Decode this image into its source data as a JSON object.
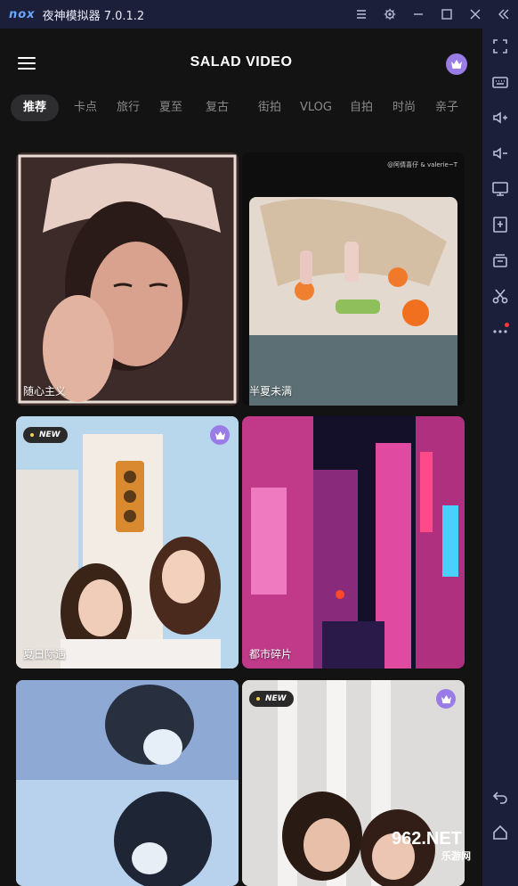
{
  "window": {
    "brand": "nox",
    "title": "夜神模拟器 7.0.1.2"
  },
  "app": {
    "title": "SALAD VIDEO"
  },
  "tabs": [
    {
      "label": "推荐",
      "active": true
    },
    {
      "label": "卡点"
    },
    {
      "label": "旅行"
    },
    {
      "label": "夏至"
    },
    {
      "label": "复古"
    },
    {
      "label": "街拍"
    },
    {
      "label": "VLOG"
    },
    {
      "label": "自拍"
    },
    {
      "label": "时尚"
    },
    {
      "label": "亲子"
    }
  ],
  "cards": [
    {
      "label": "随心主义"
    },
    {
      "label": "半夏未满",
      "credit": "@阿倩喜仔 & valerie~T"
    },
    {
      "label": "夏日际遇",
      "badge": "NEW",
      "vip": true
    },
    {
      "label": "都市碎片"
    },
    {
      "label": ""
    },
    {
      "label": "",
      "badge": "NEW",
      "vip": true
    }
  ],
  "watermark": {
    "brand": "962.NET",
    "sub": "乐游网"
  },
  "colors": {
    "accent": "#9a7ce6",
    "titlebar": "#1b1f3a",
    "screen_bg": "#131313"
  }
}
